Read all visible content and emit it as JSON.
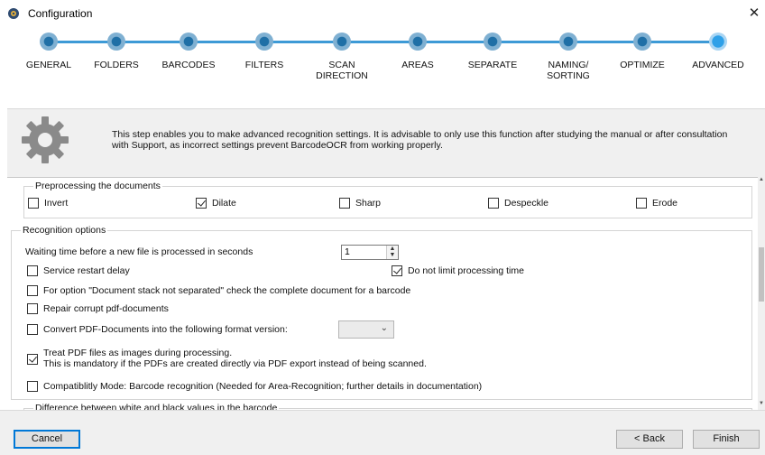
{
  "window": {
    "title": "Configuration",
    "close_glyph": "✕"
  },
  "steps": [
    {
      "label": "GENERAL",
      "active": false
    },
    {
      "label": "FOLDERS",
      "active": false
    },
    {
      "label": "BARCODES",
      "active": false
    },
    {
      "label": "FILTERS",
      "active": false
    },
    {
      "label": "SCAN\nDIRECTION",
      "active": false
    },
    {
      "label": "AREAS",
      "active": false
    },
    {
      "label": "SEPARATE",
      "active": false
    },
    {
      "label": "NAMING/\nSORTING",
      "active": false
    },
    {
      "label": "OPTIMIZE",
      "active": false
    },
    {
      "label": "ADVANCED",
      "active": true
    }
  ],
  "info": {
    "icon": "gear-icon",
    "text": "This step enables you to make advanced recognition settings. It is advisable to only use this function after studying the manual or after consultation with Support, as incorrect settings prevent BarcodeOCR from working properly."
  },
  "preprocessing": {
    "title": "Preprocessing the documents",
    "options": [
      {
        "label": "Invert",
        "checked": false
      },
      {
        "label": "Dilate",
        "checked": true
      },
      {
        "label": "Sharp",
        "checked": false
      },
      {
        "label": "Despeckle",
        "checked": false
      },
      {
        "label": "Erode",
        "checked": false
      }
    ]
  },
  "recognition": {
    "title": "Recognition options",
    "waiting_label": "Waiting time before a new file is processed in seconds",
    "waiting_value": "1",
    "service_restart": {
      "label": "Service restart delay",
      "checked": false
    },
    "no_limit": {
      "label": "Do not limit processing time",
      "checked": true
    },
    "stack_check": {
      "label": "For option \"Document stack not separated\" check the complete document for a barcode",
      "checked": false
    },
    "repair_pdf": {
      "label": "Repair corrupt pdf-documents",
      "checked": false
    },
    "convert_pdf": {
      "label": "Convert PDF-Documents into the following format version:",
      "checked": false,
      "selected": ""
    },
    "treat_pdf": {
      "label_line1": "Treat PDF files as images during processing.",
      "label_line2": "This is mandatory if the PDFs are created directly via PDF export instead of being scanned.",
      "checked": true
    },
    "compat_mode": {
      "label": "Compatiblitly Mode: Barcode recognition (Needed for Area-Recognition; further details in documentation)",
      "checked": false
    }
  },
  "difference_group": {
    "title": "Difference between white and black values in the barcode"
  },
  "footer": {
    "cancel": "Cancel",
    "back": "< Back",
    "finish": "Finish"
  }
}
